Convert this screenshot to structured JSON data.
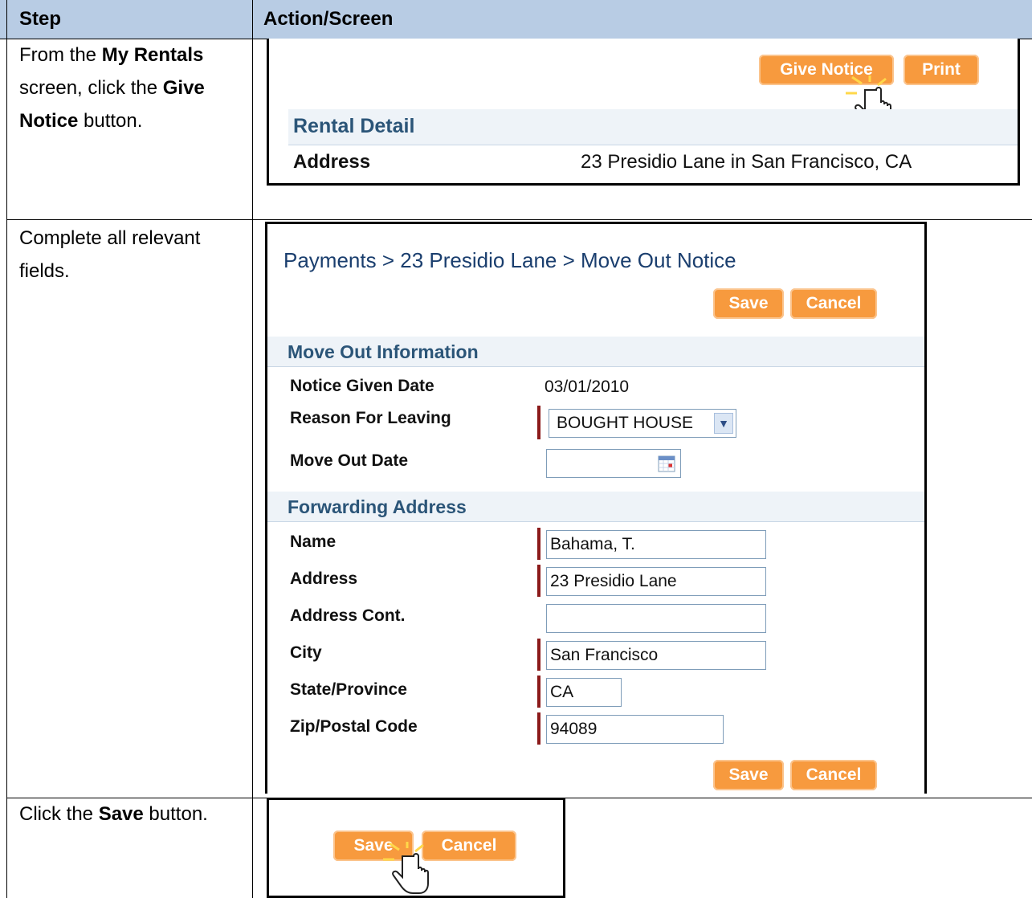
{
  "table": {
    "headers": {
      "step": "Step",
      "action": "Action/Screen"
    }
  },
  "steps": [
    {
      "pre": "From the ",
      "b1": "My Rentals",
      "mid1": " screen, click the ",
      "b2": "Give Notice",
      "post": " button."
    },
    {
      "text": "Complete all relevant fields."
    },
    {
      "pre": "Click the ",
      "b1": "Save",
      "post": " button."
    }
  ],
  "screen1": {
    "buttons": {
      "give_notice": "Give Notice",
      "print": "Print"
    },
    "section_title": "Rental Detail",
    "address_label": "Address",
    "address_value": "23 Presidio Lane in San Francisco, CA"
  },
  "screen2": {
    "breadcrumb": "Payments > 23 Presidio Lane > Move Out Notice",
    "buttons": {
      "save": "Save",
      "cancel": "Cancel"
    },
    "move_out_section": "Move Out Information",
    "notice_given_label": "Notice Given Date",
    "notice_given_value": "03/01/2010",
    "reason_label": "Reason For Leaving",
    "reason_value": "BOUGHT HOUSE",
    "move_out_date_label": "Move Out Date",
    "move_out_date_value": "",
    "forwarding_section": "Forwarding Address",
    "fields": {
      "name_label": "Name",
      "name_value": "Bahama, T.",
      "address_label": "Address",
      "address_value": "23 Presidio Lane",
      "address_cont_label": "Address Cont.",
      "address_cont_value": "",
      "city_label": "City",
      "city_value": "San Francisco",
      "state_label": "State/Province",
      "state_value": "CA",
      "zip_label": "Zip/Postal Code",
      "zip_value": "94089"
    }
  },
  "screen3": {
    "buttons": {
      "save": "Save",
      "cancel": "Cancel"
    }
  },
  "colors": {
    "header_bg": "#b8cce4",
    "button_orange": "#f79a3e",
    "section_text": "#2b5578",
    "required_marker": "#8b1a1a"
  },
  "icons": [
    "pointer-hand-icon",
    "calendar-icon",
    "dropdown-arrow-icon"
  ]
}
